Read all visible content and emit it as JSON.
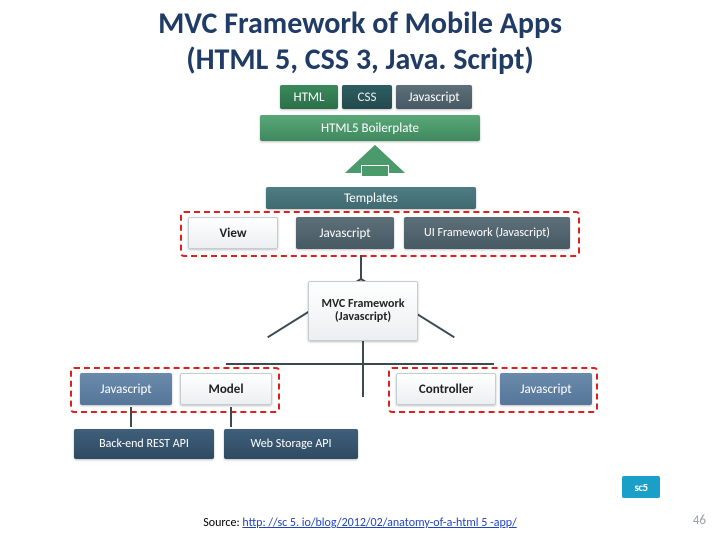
{
  "title_line1": "MVC Framework of Mobile Apps",
  "title_line2": "(HTML 5, CSS 3, Java. Script)",
  "top": {
    "html": "HTML",
    "css": "CSS",
    "js": "Javascript"
  },
  "boilerplate": "HTML5 Boilerplate",
  "templates": "Templates",
  "view_row": {
    "view": "View",
    "js": "Javascript",
    "uifw": "UI Framework (Javascript)"
  },
  "mvc": "MVC Framework (Javascript)",
  "model_row": {
    "js": "Javascript",
    "model": "Model"
  },
  "controller_row": {
    "controller": "Controller",
    "js": "Javascript"
  },
  "apis": {
    "backend": "Back-end REST API",
    "storage": "Web Storage API"
  },
  "source_prefix": "Source: ",
  "source_url": "http: //sc 5. io/blog/2012/02/anatomy-of-a-html 5 -app/",
  "logo": "sc5",
  "page_number": "46"
}
